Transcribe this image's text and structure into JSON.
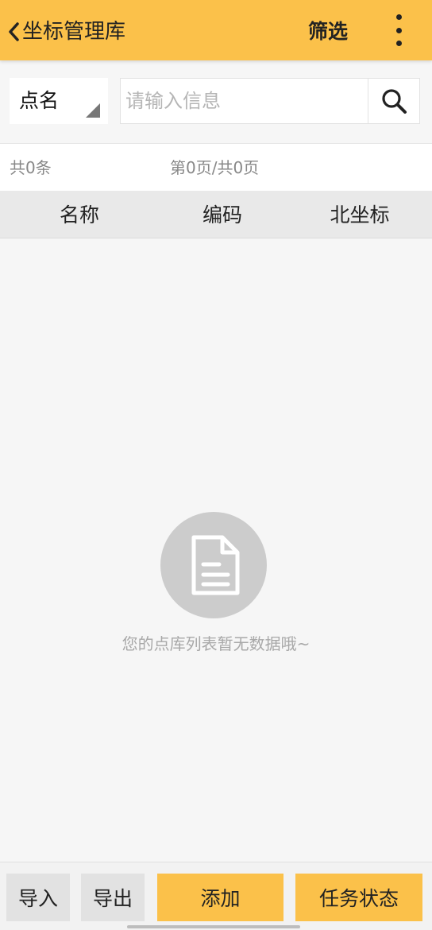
{
  "header": {
    "title": "坐标管理库",
    "filter_label": "筛选"
  },
  "search": {
    "type_label": "点名",
    "placeholder": "请输入信息",
    "value": ""
  },
  "info": {
    "total": "共0条",
    "page": "第0页/共0页"
  },
  "table": {
    "columns": [
      "名称",
      "编码",
      "北坐标"
    ],
    "rows": []
  },
  "empty": {
    "message": "您的点库列表暂无数据哦~"
  },
  "bottom": {
    "import_label": "导入",
    "export_label": "导出",
    "add_label": "添加",
    "status_label": "任务状态"
  },
  "colors": {
    "accent": "#fbc14a",
    "background": "#f6f6f6",
    "empty_icon": "#cccccc"
  }
}
